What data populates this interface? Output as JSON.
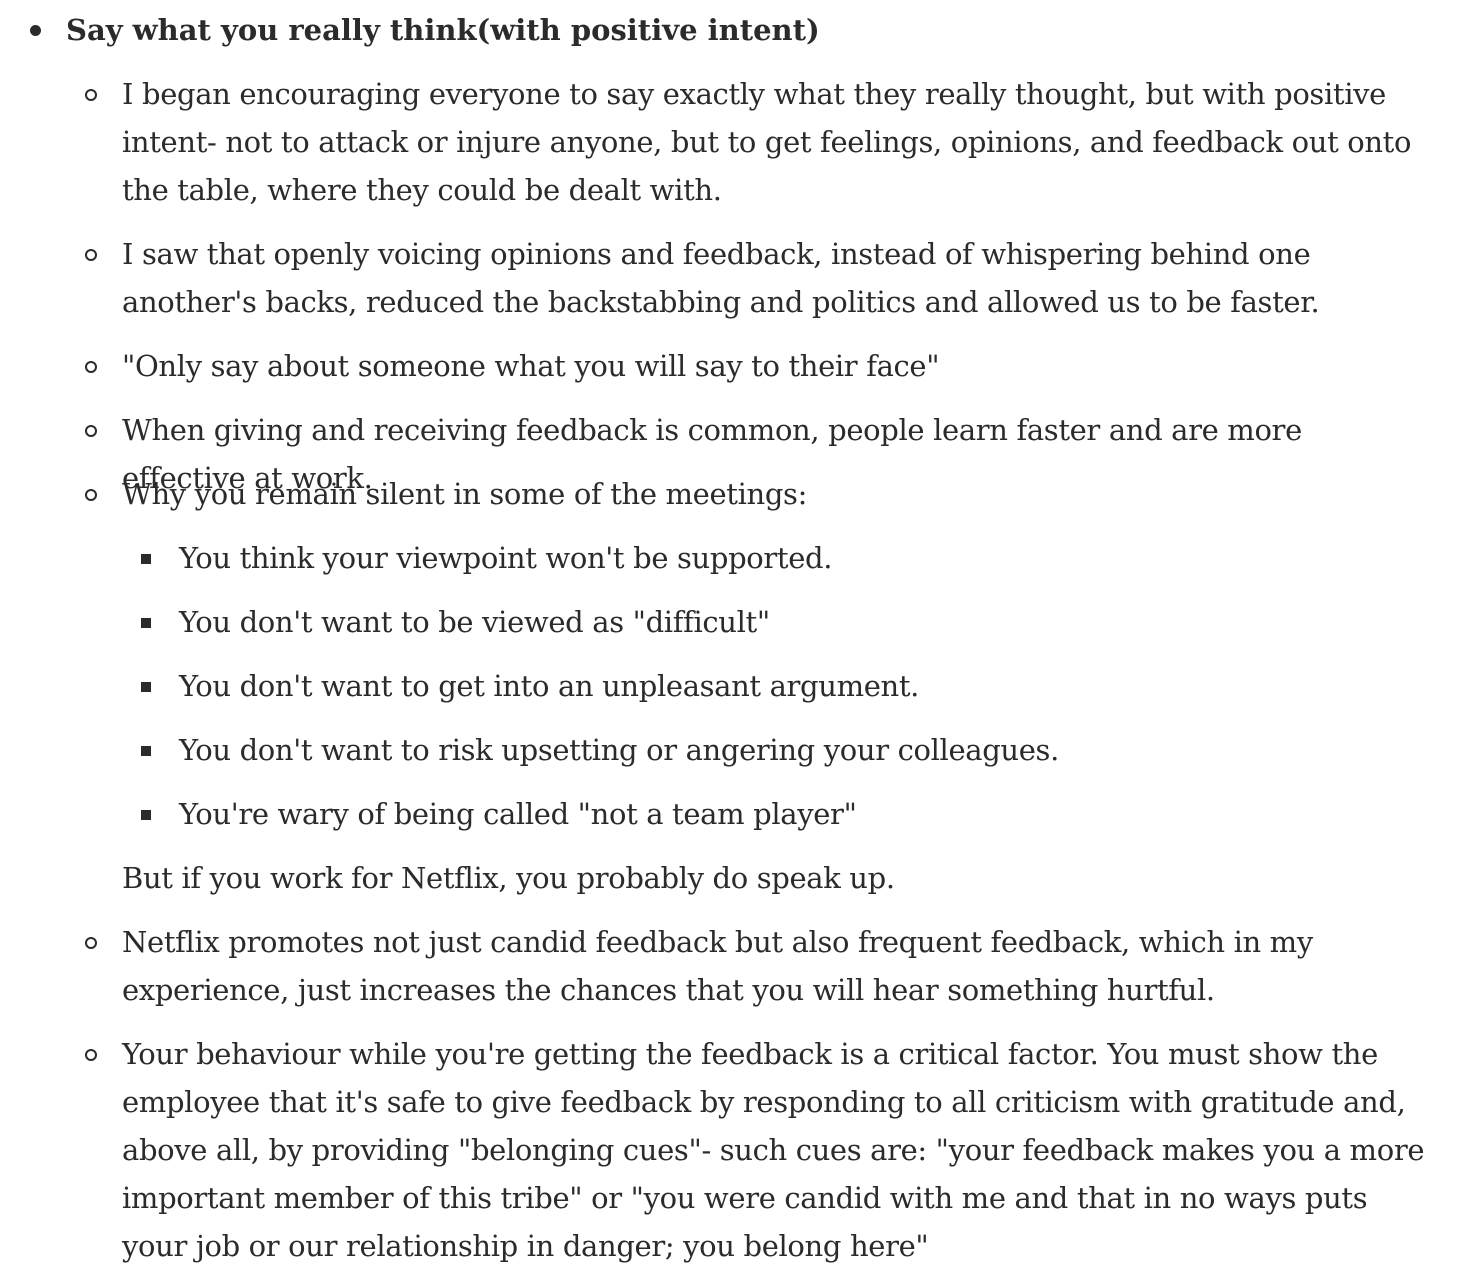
{
  "heading": "Say what you really think(with positive intent)",
  "points": [
    "I began encouraging everyone to say exactly what they really thought, but with positive intent- not to attack or injure anyone, but to get feelings, opinions, and feedback out onto the table, where they could be dealt with.",
    "I saw that openly voicing opinions and feedback, instead of whispering behind one another's backs, reduced the backstabbing and politics and allowed us to be faster.",
    "\"Only say about someone what you will say to their face\"",
    "When giving and receiving feedback is common, people learn faster and are more effective at work.",
    "Why you remain silent in some of the meetings:"
  ],
  "silent_reasons": [
    "You think your viewpoint won't be supported.",
    "You don't want to be viewed as \"difficult\"",
    "You don't want to get into an unpleasant argument.",
    "You don't want to risk upsetting or angering your colleagues.",
    "You're wary of being called \"not a team player\""
  ],
  "netflix_note": "But if you work for Netflix, you probably do speak up.",
  "more_points": [
    "Netflix promotes not just candid feedback but also frequent feedback, which in my experience, just increases the chances that you will hear something hurtful.",
    "Your behaviour while you're getting the feedback is a critical factor. You must show the employee that it's safe to give feedback by responding to all criticism with gratitude and, above all, by providing \"belonging cues\"- such cues are: \"your feedback makes you a more important member of this tribe\" or \"you were candid with me and that in no ways puts your job or our relationship in danger; you belong here\""
  ]
}
